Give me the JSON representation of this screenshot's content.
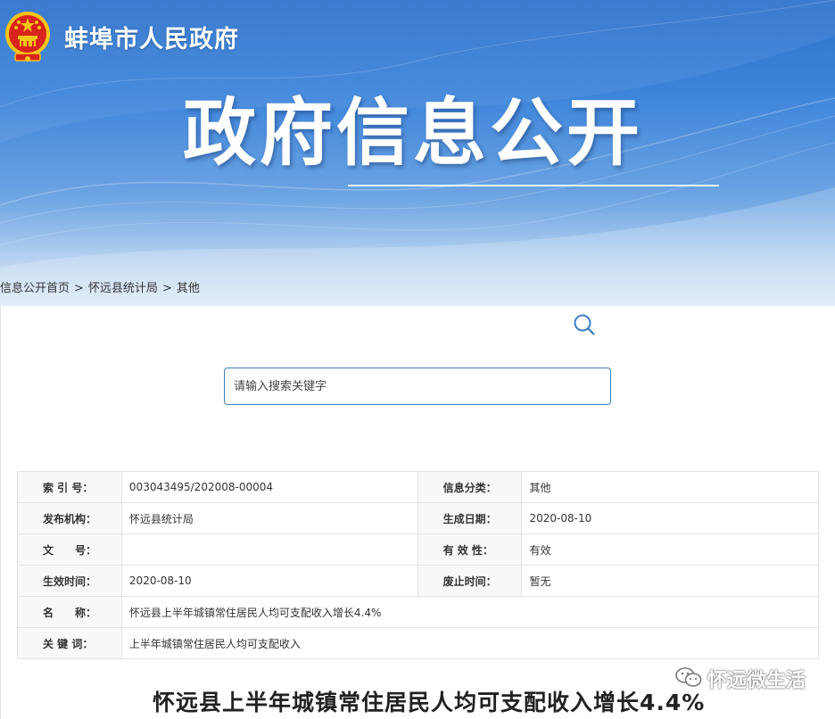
{
  "header": {
    "site_name": "蚌埠市人民政府",
    "banner_title": "政府信息公开",
    "emblem": "national-emblem"
  },
  "breadcrumb": [
    "信息公开首页",
    "怀远县统计局",
    "其他"
  ],
  "breadcrumb_sep": ">",
  "search": {
    "placeholder": "请输入搜索关键字",
    "value": "",
    "icon": "search-icon"
  },
  "meta_table": {
    "index_no_label": "索 引 号：",
    "index_no": "003043495/202008-00004",
    "category_label": "信息分类：",
    "category": "其他",
    "publisher_label": "发布机构：",
    "publisher": "怀远县统计局",
    "created_label": "生成日期：",
    "created": "2020-08-10",
    "doc_no_label": "文　　号：",
    "doc_no": "",
    "validity_label": "有 效 性：",
    "validity": "有效",
    "effective_label": "生效时间：",
    "effective": "2020-08-10",
    "expiry_label": "废止时间：",
    "expiry": "暂无",
    "name_label": "名　　称：",
    "name": "怀远县上半年城镇常住居民人均可支配收入增长4.4%",
    "keywords_label": "关 键 词：",
    "keywords": "上半年城镇常住居民人均可支配收入"
  },
  "article": {
    "title": "怀远县上半年城镇常住居民人均可支配收入增长4.4%"
  },
  "watermark": {
    "text": "怀远微生活",
    "icon": "wechat-icon"
  },
  "colors": {
    "banner_blue": "#2f73cc",
    "search_border": "#3b7fc4",
    "emblem_red": "#d8241c",
    "emblem_gold": "#f5c518"
  }
}
